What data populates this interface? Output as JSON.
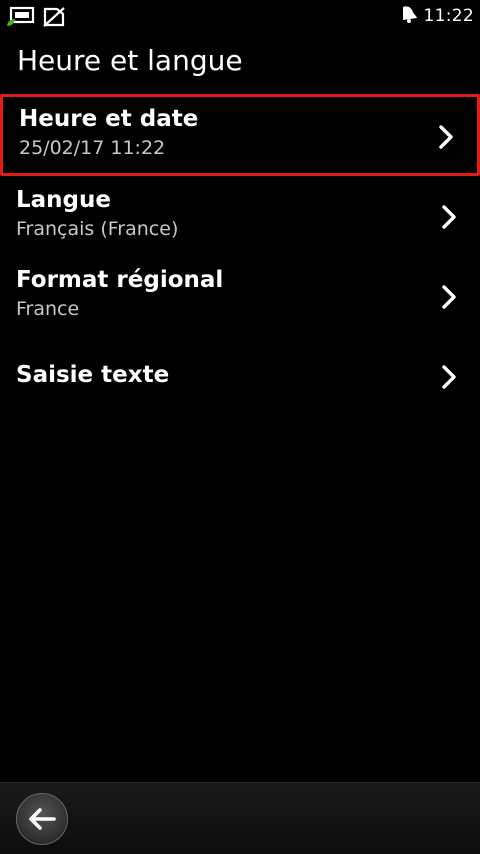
{
  "status_bar": {
    "time": "11:22",
    "icons": [
      "usb-charging-icon",
      "no-sim-icon",
      "notification-bell-icon"
    ]
  },
  "page": {
    "title": "Heure et langue"
  },
  "settings": {
    "items": [
      {
        "title": "Heure et date",
        "subtitle": "25/02/17 11:22",
        "selected": true
      },
      {
        "title": "Langue",
        "subtitle": "Français (France)",
        "selected": false
      },
      {
        "title": "Format régional",
        "subtitle": "France",
        "selected": false
      },
      {
        "title": "Saisie texte",
        "subtitle": "",
        "selected": false
      }
    ]
  },
  "toolbar": {
    "back_icon": "back-arrow-icon"
  },
  "colors": {
    "background": "#000000",
    "selection_border": "#e01b1b",
    "subtitle_text": "#c8c8c8",
    "usb_leaf_accent": "#4caf2a"
  }
}
